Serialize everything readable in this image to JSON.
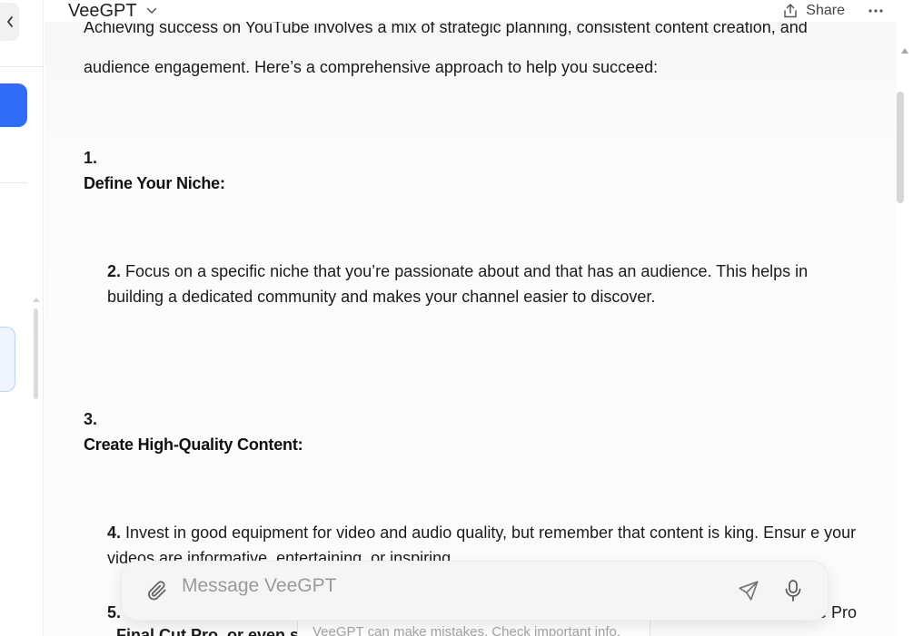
{
  "header": {
    "model_name": "VeeGPT",
    "share_label": "Share"
  },
  "conversation": {
    "intro_line1": "Achieving success on YouTube involves a mix of strategic planning, consistent content creation, and",
    "intro_line2": "audience engagement. Here’s a comprehensive approach to help you succeed:",
    "sections": [
      {
        "number": "1.",
        "heading": "Define Your Niche:"
      },
      {
        "number": "3.",
        "heading": "Create High-Quality Content:"
      }
    ],
    "items": [
      {
        "number": "2.",
        "text": "Focus on a specific niche that you’re passionate about and that has an audience. This helps in building a dedicated community and makes your channel easier to discover."
      },
      {
        "number": "4.",
        "text": "Invest in good equipment for video and audio quality, but remember that content is king. Ensur e your videos are informative, entertaining, or inspiring."
      }
    ],
    "partial_item_number": "5.",
    "partial_item_right": "e Pro",
    "partial_item_line2": "Final Cut Pro, or even si"
  },
  "composer": {
    "placeholder": "Message VeeGPT",
    "disclaimer": "VeeGPT can make mistakes. Check important info."
  },
  "icons": {
    "collapse": "chevron-left-icon",
    "model_dropdown": "chevron-down-icon",
    "share": "share-icon",
    "more": "ellipsis-icon",
    "attach": "paperclip-icon",
    "send": "send-icon",
    "mic": "microphone-icon"
  },
  "colors": {
    "accent": "#2f6df6",
    "selected_bg": "#eff5ff",
    "selected_border": "#b9d3f4"
  }
}
